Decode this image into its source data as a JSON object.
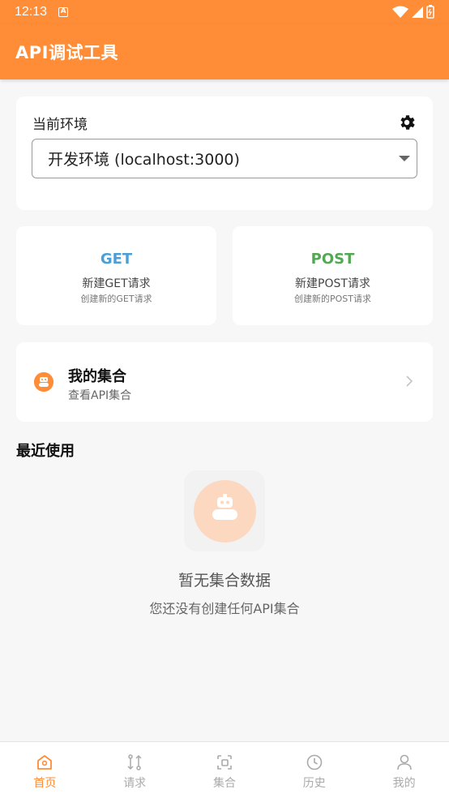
{
  "status_bar": {
    "time": "12:13",
    "badge": "A"
  },
  "app_bar": {
    "title": "API调试工具"
  },
  "environment": {
    "label": "当前环境",
    "selected": "开发环境 (localhost:3000)",
    "settings_icon": "gear-icon"
  },
  "quick_actions": [
    {
      "method": "GET",
      "title": "新建GET请求",
      "subtitle": "创建新的GET请求",
      "color": "#4a9fd8"
    },
    {
      "method": "POST",
      "title": "新建POST请求",
      "subtitle": "创建新的POST请求",
      "color": "#53a853"
    }
  ],
  "collections": {
    "title": "我的集合",
    "subtitle": "查看API集合",
    "icon": "robot-icon"
  },
  "recent": {
    "title": "最近使用",
    "empty_title": "暂无集合数据",
    "empty_subtitle": "您还没有创建任何API集合"
  },
  "bottom_nav": [
    {
      "label": "首页",
      "icon": "home-icon",
      "active": true
    },
    {
      "label": "请求",
      "icon": "request-icon",
      "active": false
    },
    {
      "label": "集合",
      "icon": "collection-icon",
      "active": false
    },
    {
      "label": "历史",
      "icon": "clock-icon",
      "active": false
    },
    {
      "label": "我的",
      "icon": "user-icon",
      "active": false
    }
  ],
  "colors": {
    "accent": "#ff8c36",
    "background": "#f7f7f7"
  }
}
